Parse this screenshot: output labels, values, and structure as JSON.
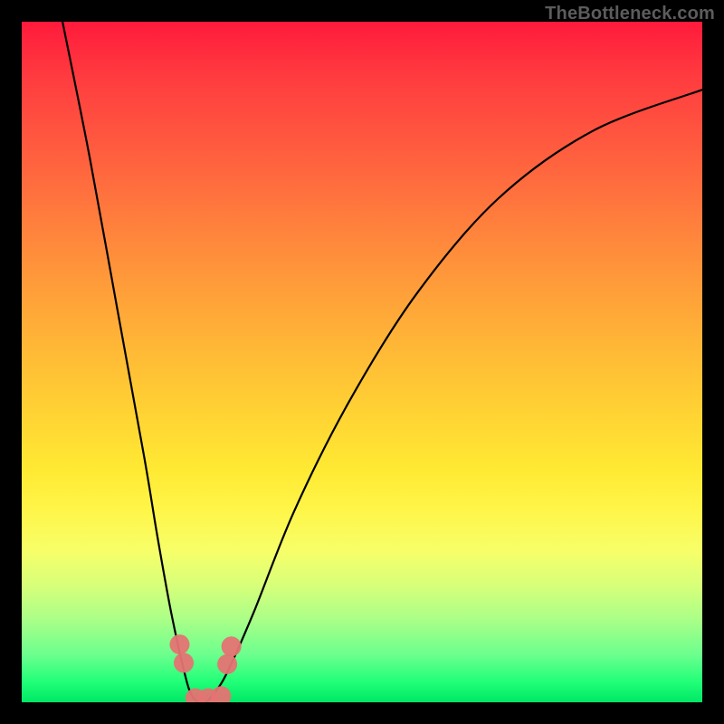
{
  "watermark": "TheBottleneck.com",
  "chart_data": {
    "type": "line",
    "title": "",
    "xlabel": "",
    "ylabel": "",
    "xlim": [
      0,
      100
    ],
    "ylim": [
      0,
      100
    ],
    "series": [
      {
        "name": "bottleneck-curve",
        "x": [
          6,
          10,
          14,
          18,
          20,
          22,
          24,
          25,
          26,
          27,
          28,
          30,
          34,
          40,
          48,
          58,
          70,
          84,
          100
        ],
        "values": [
          100,
          80,
          58,
          36,
          24,
          13,
          4,
          1,
          0,
          0,
          1,
          4,
          13,
          28,
          44,
          60,
          74,
          84,
          90
        ]
      }
    ],
    "markers": [
      {
        "name": "dip-left-upper",
        "x": 23.2,
        "y": 8.5
      },
      {
        "name": "dip-left-lower",
        "x": 23.8,
        "y": 5.8
      },
      {
        "name": "dip-right-upper",
        "x": 30.8,
        "y": 8.2
      },
      {
        "name": "dip-right-lower",
        "x": 30.2,
        "y": 5.6
      },
      {
        "name": "trough-left",
        "x": 25.5,
        "y": 0.6
      },
      {
        "name": "trough-mid",
        "x": 27.4,
        "y": 0.6
      },
      {
        "name": "trough-right",
        "x": 29.3,
        "y": 0.9
      }
    ],
    "marker_style": {
      "radius": 11,
      "fill": "#e57373",
      "alpha": 0.95
    },
    "gradient_stops": [
      {
        "pos": 0,
        "color": "#ff1a3c"
      },
      {
        "pos": 50,
        "color": "#ffd433"
      },
      {
        "pos": 100,
        "color": "#00e765"
      }
    ]
  }
}
